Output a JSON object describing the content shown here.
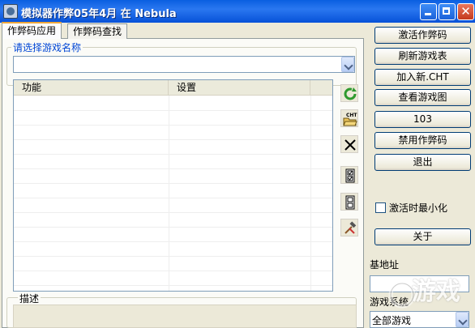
{
  "window": {
    "title": "模拟器作弊05年4月  在 Nebula"
  },
  "tabs": [
    "作弊码应用",
    "作弊码查找"
  ],
  "game_select": {
    "label": "请选择游戏名称",
    "value": ""
  },
  "cheat_list": {
    "columns": [
      "功能",
      "设置"
    ],
    "rows": []
  },
  "description": {
    "label": "描述",
    "value": ""
  },
  "buttons": {
    "activate": "激活作弊码",
    "refresh_games": "刷新游戏表",
    "add_cht": "加入新.CHT",
    "view_game": "查看游戏图",
    "count": "103",
    "disable": "禁用作弊码",
    "exit": "退出",
    "about": "关于"
  },
  "minimize_on_activate": {
    "label": "激活时最小化",
    "checked": false
  },
  "base_address": {
    "label": "基地址",
    "value": ""
  },
  "game_system": {
    "label": "游戏系统",
    "selected": "全部游戏"
  },
  "side_icons": [
    "refresh-icon",
    "open-cht-icon",
    "delete-icon",
    "check-all-icon",
    "uncheck-all-icon",
    "tools-icon"
  ],
  "watermark": {
    "text": "游戏"
  },
  "colors": {
    "title_bar": "#0a5fe0",
    "close_button": "#c4391d",
    "tab_highlight": "#f0a73a",
    "group_label": "#0046d5"
  }
}
